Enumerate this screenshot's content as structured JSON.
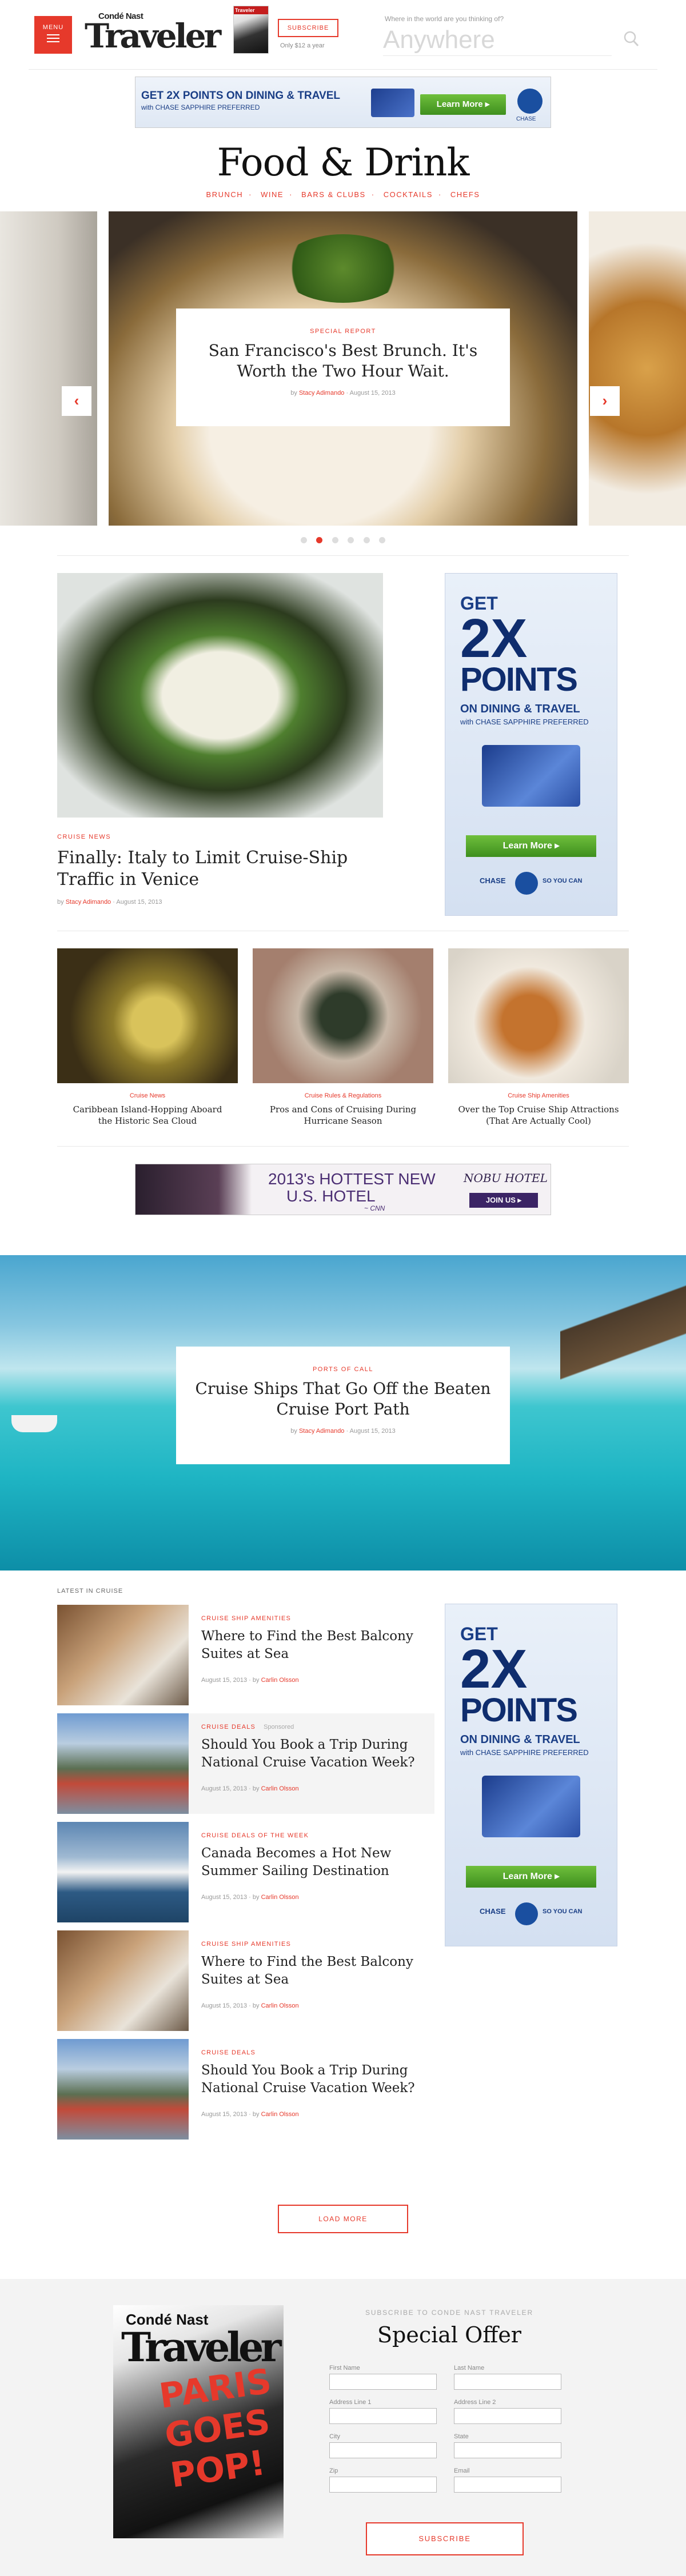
{
  "header": {
    "menu_label": "MENU",
    "logo_small": "Condé Nast",
    "logo_big": "Traveler",
    "mag_thumb_title": "Traveler",
    "subscribe_label": "SUBSCRIBE",
    "subscribe_note": "Only $12 a year",
    "search_label": "Where in the world are you thinking of?",
    "search_placeholder": "Anywhere"
  },
  "ad_top": {
    "headline": "GET 2X POINTS ON DINING & TRAVEL",
    "sub": "with CHASE SAPPHIRE PREFERRED",
    "cta": "Learn More ▸",
    "brand": "CHASE"
  },
  "page": {
    "title": "Food & Drink",
    "subnav": [
      "BRUNCH",
      "WINE",
      "BARS & CLUBS",
      "COCKTAILS",
      "CHEFS"
    ]
  },
  "carousel": {
    "kicker": "SPECIAL REPORT",
    "title": "San Francisco's Best Brunch. It's Worth the Two Hour Wait.",
    "by": "by",
    "author": "Stacy Adimando",
    "date": "August 15, 2013",
    "prev_icon": "‹",
    "next_icon": "›",
    "dots": 6,
    "active_dot": 2
  },
  "feature": {
    "kicker": "CRUISE NEWS",
    "title": "Finally: Italy to Limit Cruise-Ship Traffic in Venice",
    "by": "by",
    "author": "Stacy Adimando",
    "date": "August 15, 2013"
  },
  "side_ad": {
    "get": "GET",
    "big": "2X",
    "points": "POINTS",
    "dining": "ON DINING & TRAVEL",
    "with": "with CHASE SAPPHIRE PREFERRED",
    "cta": "Learn More ▸",
    "brand": "CHASE",
    "tagline": "SO YOU CAN"
  },
  "cards": [
    {
      "kicker": "Cruise News",
      "title": "Caribbean Island-Hopping Aboard the Historic Sea Cloud"
    },
    {
      "kicker": "Cruise Rules & Regulations",
      "title": "Pros and Cons of Cruising During Hurricane Season"
    },
    {
      "kicker": "Cruise Ship Amenities",
      "title": "Over the Top Cruise Ship Attractions (That Are Actually Cool)"
    }
  ],
  "leader_ad": {
    "line1": "2013's HOTTEST NEW",
    "line2": "U.S. HOTEL",
    "cnn": "~ CNN",
    "brand": "NOBU HOTEL",
    "cta": "JOIN US ▸"
  },
  "ocean_story": {
    "kicker": "PORTS OF CALL",
    "title": "Cruise Ships That Go Off the Beaten Cruise Port Path",
    "by": "by",
    "author": "Stacy Adimando",
    "date": "August 15, 2013"
  },
  "latest": {
    "label": "LATEST IN CRUISE",
    "items": [
      {
        "kicker": "CRUISE SHIP AMENITIES",
        "title": "Where to Find the Best Balcony Suites at Sea",
        "date": "August 15, 2013",
        "by": "by",
        "author": "Carlin Olsson",
        "sponsored": ""
      },
      {
        "kicker": "CRUISE DEALS",
        "title": "Should You Book a Trip During National Cruise Vacation Week?",
        "date": "August 15, 2013",
        "by": "by",
        "author": "Carlin Olsson",
        "sponsored": "Sponsored"
      },
      {
        "kicker": "CRUISE DEALS OF THE WEEK",
        "title": "Canada Becomes a Hot New Summer Sailing Destination",
        "date": "August 15, 2013",
        "by": "by",
        "author": "Carlin Olsson",
        "sponsored": ""
      },
      {
        "kicker": "CRUISE SHIP AMENITIES",
        "title": "Where to Find the Best Balcony Suites at Sea",
        "date": "August 15, 2013",
        "by": "by",
        "author": "Carlin Olsson",
        "sponsored": ""
      },
      {
        "kicker": "CRUISE DEALS",
        "title": "Should You Book a Trip During National Cruise Vacation Week?",
        "date": "August 15, 2013",
        "by": "by",
        "author": "Carlin Olsson",
        "sponsored": ""
      }
    ],
    "load_more": "LOAD MORE"
  },
  "offer": {
    "cover_top": "Condé Nast",
    "cover_title": "Traveler",
    "cover_hook": "PARIS GOES POP!",
    "pre": "SUBSCRIBE TO CONDE NAST TRAVELER",
    "title": "Special Offer",
    "fields": {
      "first_name": "First Name",
      "last_name": "Last Name",
      "address1": "Address Line 1",
      "address2": "Address Line 2",
      "city": "City",
      "state": "State",
      "zip": "Zip",
      "email": "Email"
    },
    "submit": "SUBSCRIBE"
  },
  "colors": {
    "accent": "#e6392b",
    "chase_blue": "#1a3e86"
  },
  "icons": {
    "search": "search-icon",
    "menu": "hamburger-icon"
  }
}
